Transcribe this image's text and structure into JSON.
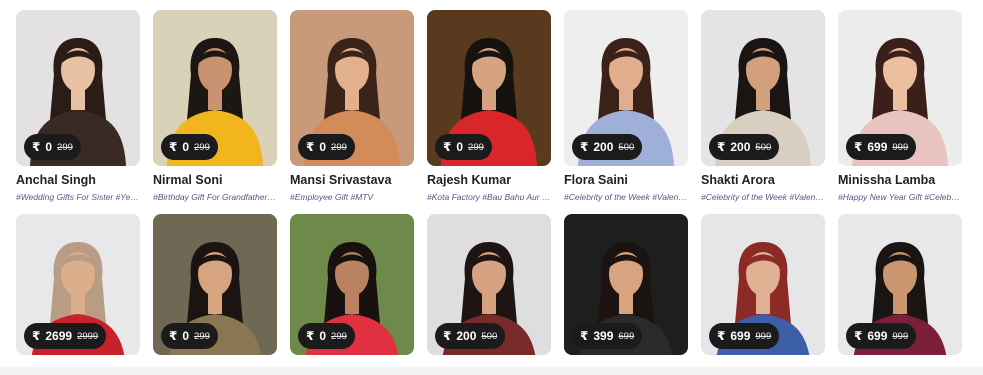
{
  "currency_symbol": "₹",
  "cards": [
    {
      "name": "Anchal Singh",
      "price": "0",
      "old_price": "299",
      "tags": "#Wedding Gifts For Sister #Yeh Ka...",
      "bg": "#e4e1e2",
      "skin": "#e8c0a2",
      "hair": "#2a1c16",
      "outfit": "#3a2a24"
    },
    {
      "name": "Nirmal Soni",
      "price": "0",
      "old_price": "299",
      "tags": "#Birthday Gift For Grandfather #...",
      "bg": "#d9d2b8",
      "skin": "#c99270",
      "hair": "#1d1714",
      "outfit": "#f2b51e"
    },
    {
      "name": "Mansi Srivastava",
      "price": "0",
      "old_price": "299",
      "tags": "#Employee Gift #MTV",
      "bg": "#c99a7a",
      "skin": "#e3b08e",
      "hair": "#3a241a",
      "outfit": "#d28c5a"
    },
    {
      "name": "Rajesh Kumar",
      "price": "0",
      "old_price": "299",
      "tags": "#Kota Factory #Bau Bahu Aur Ba...",
      "bg": "#5a3a1f",
      "skin": "#d7a280",
      "hair": "#151210",
      "outfit": "#d8262a"
    },
    {
      "name": "Flora Saini",
      "price": "200",
      "old_price": "500",
      "tags": "#Celebrity of the Week #Valentin...",
      "bg": "#eeeeee",
      "skin": "#e0ae8c",
      "hair": "#3b2219",
      "outfit": "#9fb0d8"
    },
    {
      "name": "Shakti Arora",
      "price": "200",
      "old_price": "500",
      "tags": "#Celebrity of the Week #Valentin...",
      "bg": "#e4e4e6",
      "skin": "#d2a07c",
      "hair": "#1a1412",
      "outfit": "#d8cfc1"
    },
    {
      "name": "Minissha Lamba",
      "price": "699",
      "old_price": "999",
      "tags": "#Happy New Year Gift #Celebrity ...",
      "bg": "#ececed",
      "skin": "#ebbf9f",
      "hair": "#3b1f1a",
      "outfit": "#e7c4c0"
    },
    {
      "name": "",
      "price": "2699",
      "old_price": "2999",
      "tags": "",
      "bg": "#e8e8ea",
      "skin": "#dcae8a",
      "hair": "#b89c86",
      "outfit": "#c8212a"
    },
    {
      "name": "",
      "price": "0",
      "old_price": "299",
      "tags": "",
      "bg": "#6e6854",
      "skin": "#d6a47f",
      "hair": "#1b1412",
      "outfit": "#8a7752"
    },
    {
      "name": "",
      "price": "0",
      "old_price": "299",
      "tags": "",
      "bg": "#6d8a4a",
      "skin": "#b98362",
      "hair": "#17120f",
      "outfit": "#e13040"
    },
    {
      "name": "",
      "price": "200",
      "old_price": "500",
      "tags": "",
      "bg": "#dedee0",
      "skin": "#d6a282",
      "hair": "#1d1513",
      "outfit": "#7b2a2a"
    },
    {
      "name": "",
      "price": "399",
      "old_price": "699",
      "tags": "",
      "bg": "#1e1e1e",
      "skin": "#d7a47f",
      "hair": "#1a1310",
      "outfit": "#2a2a2a"
    },
    {
      "name": "",
      "price": "699",
      "old_price": "999",
      "tags": "",
      "bg": "#e6e6e8",
      "skin": "#e0b092",
      "hair": "#8c2a26",
      "outfit": "#3c5fa8"
    },
    {
      "name": "",
      "price": "699",
      "old_price": "999",
      "tags": "",
      "bg": "#e8e8ea",
      "skin": "#c9966f",
      "hair": "#1a1412",
      "outfit": "#7a1e3a"
    }
  ]
}
